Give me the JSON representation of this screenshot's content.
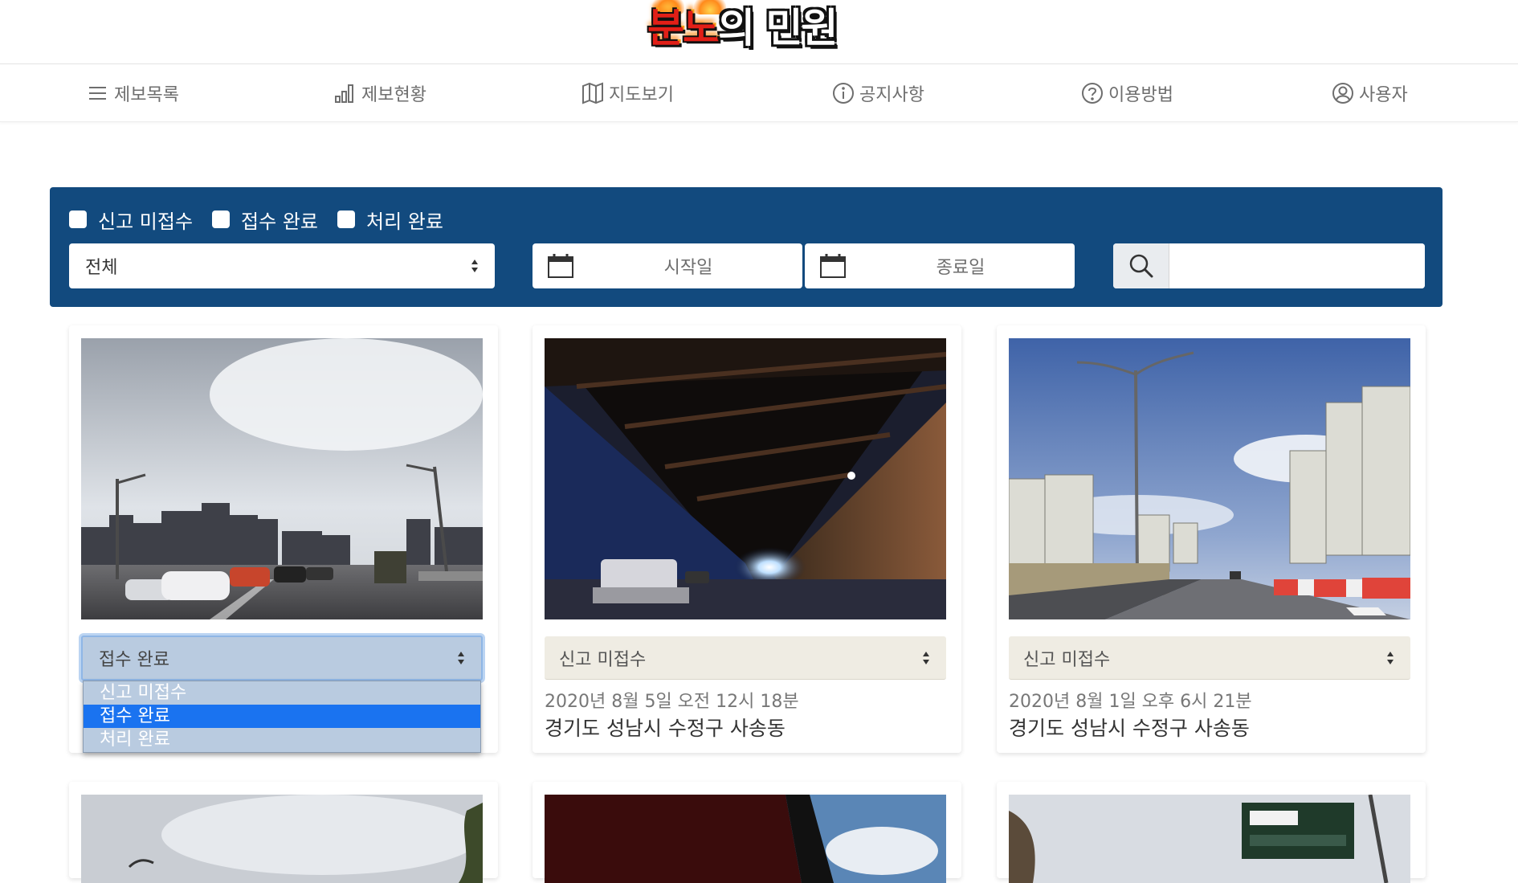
{
  "header": {
    "logo_text_1": "분노",
    "logo_text_2": "의 민원"
  },
  "nav": {
    "items": [
      {
        "label": "제보목록",
        "icon": "menu-icon"
      },
      {
        "label": "제보현황",
        "icon": "bar-chart-icon"
      },
      {
        "label": "지도보기",
        "icon": "map-icon"
      },
      {
        "label": "공지사항",
        "icon": "info-icon"
      },
      {
        "label": "이용방법",
        "icon": "help-icon"
      },
      {
        "label": "사용자",
        "icon": "user-icon"
      }
    ]
  },
  "filter": {
    "checkboxes": [
      "신고 미접수",
      "접수 완료",
      "처리 완료"
    ],
    "category_value": "전체",
    "start_date_placeholder": "시작일",
    "end_date_placeholder": "종료일",
    "search_placeholder": "",
    "colors": {
      "panel": "#124a7e"
    }
  },
  "cards": [
    {
      "status": "접수 완료",
      "dropdown_open": true,
      "options": [
        "신고 미접수",
        "접수 완료",
        "처리 완료"
      ],
      "selected_option": "접수 완료",
      "photo": "highway-photo"
    },
    {
      "status": "신고 미접수",
      "date": "2020년 8월 5일  오전 12시 18분",
      "location": "경기도 성남시 수정구 사송동",
      "photo": "tunnel-photo"
    },
    {
      "status": "신고 미접수",
      "date": "2020년 8월 1일  오후 6시 21분",
      "location": "경기도 성남시 수정구 사송동",
      "photo": "road-photo"
    }
  ]
}
